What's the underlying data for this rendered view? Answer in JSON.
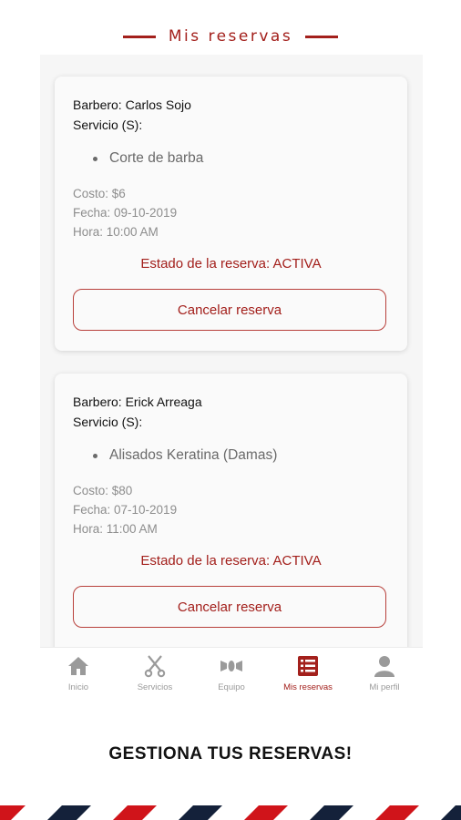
{
  "header": {
    "title": "Mis reservas"
  },
  "reservations": [
    {
      "barber": "Barbero: Carlos Sojo",
      "servicio_label": "Servicio (S):",
      "services": [
        "Corte de barba"
      ],
      "costo": "Costo: $6",
      "fecha": "Fecha: 09-10-2019",
      "hora": "Hora: 10:00 AM",
      "estado": "Estado de la reserva: ACTIVA",
      "cancel_label": "Cancelar reserva"
    },
    {
      "barber": "Barbero: Erick Arreaga",
      "servicio_label": "Servicio (S):",
      "services": [
        "Alisados Keratina (Damas)"
      ],
      "costo": "Costo: $80",
      "fecha": "Fecha: 07-10-2019",
      "hora": "Hora: 11:00 AM",
      "estado": "Estado de la reserva: ACTIVA",
      "cancel_label": "Cancelar reserva"
    }
  ],
  "tabbar": {
    "tabs": [
      {
        "label": "Inicio",
        "icon": "home-icon"
      },
      {
        "label": "Servicios",
        "icon": "scissors-icon"
      },
      {
        "label": "Equipo",
        "icon": "team-icon"
      },
      {
        "label": "Mis reservas",
        "icon": "list-icon",
        "active": true
      },
      {
        "label": "Mi perfil",
        "icon": "user-icon"
      }
    ]
  },
  "tagline": "GESTIONA TUS RESERVAS!",
  "colors": {
    "accent": "#a3201c",
    "navy": "#14213a",
    "stripe_red": "#d0141a",
    "inactive": "#9a9a9a"
  }
}
